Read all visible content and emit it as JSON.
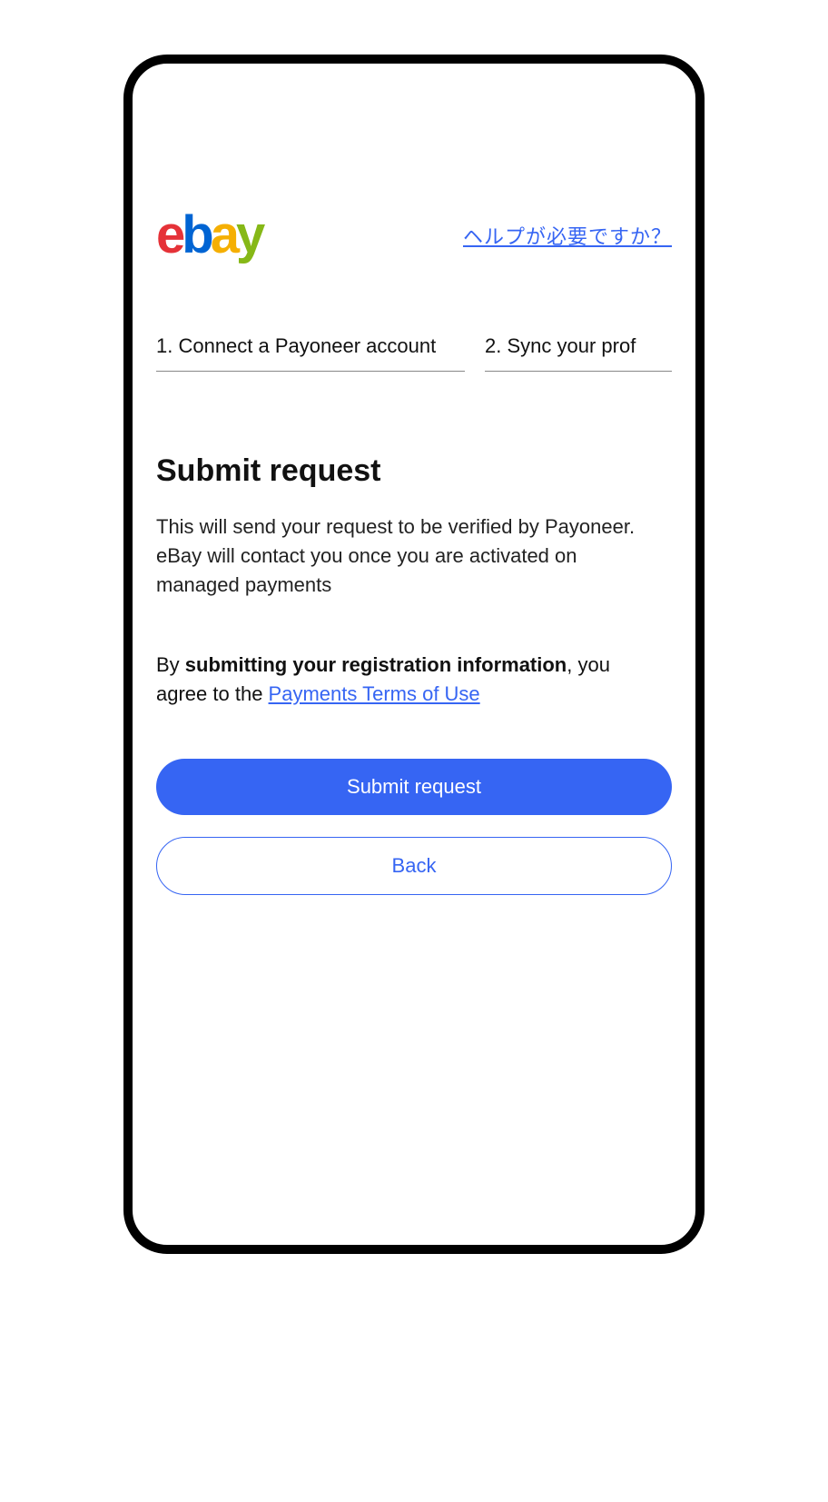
{
  "header": {
    "logo": {
      "e": "e",
      "b": "b",
      "a": "a",
      "y": "y"
    },
    "help_link": "ヘルプが必要ですか？"
  },
  "tabs": {
    "tab1": "1. Connect a Payoneer account",
    "tab2": "2. Sync your prof"
  },
  "main": {
    "title": "Submit request",
    "description": "This will send your request to be verified by Payoneer. eBay will contact you once you are activated on managed payments",
    "agreement_prefix": "By ",
    "agreement_bold": "submitting your registration information",
    "agreement_middle": ", you agree to the ",
    "agreement_link": "Payments Terms of Use"
  },
  "buttons": {
    "submit": "Submit request",
    "back": "Back"
  }
}
